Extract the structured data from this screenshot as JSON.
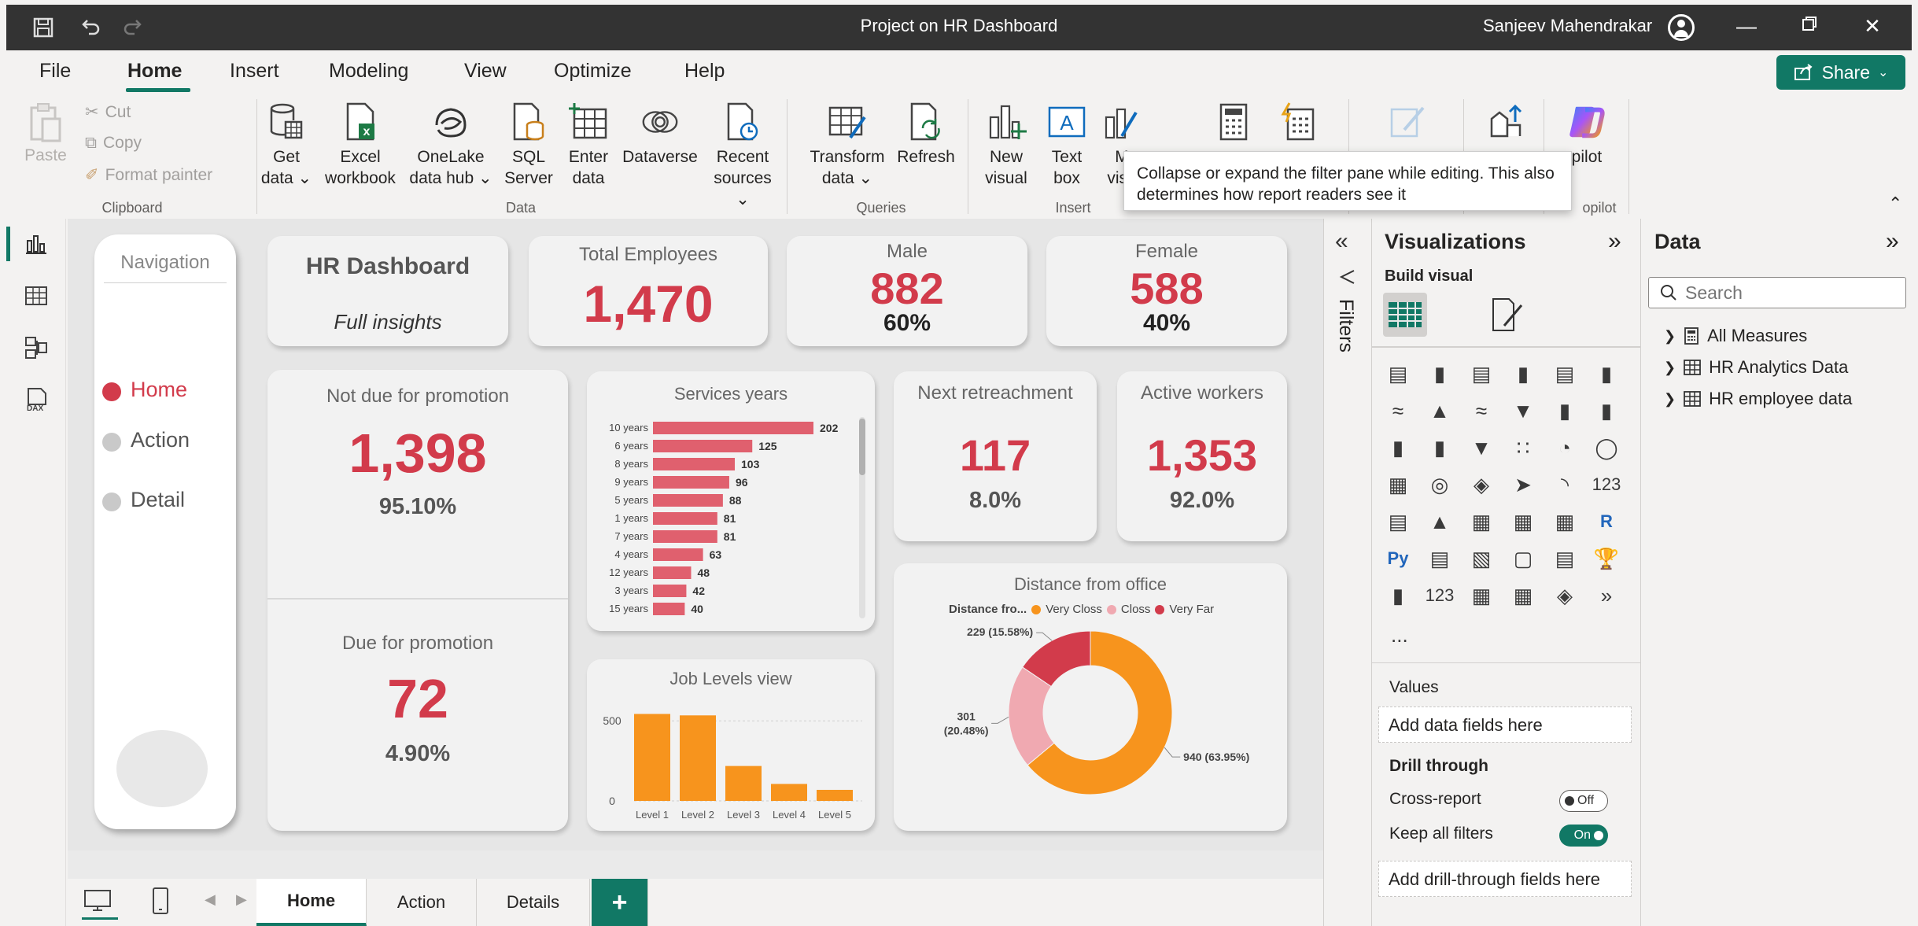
{
  "window": {
    "title": "Project on HR Dashboard",
    "user": "Sanjeev Mahendrakar"
  },
  "menu": {
    "items": [
      "File",
      "Home",
      "Insert",
      "Modeling",
      "View",
      "Optimize",
      "Help"
    ],
    "share_label": "Share"
  },
  "ribbon": {
    "clipboard": {
      "paste": "Paste",
      "cut": "Cut",
      "copy": "Copy",
      "format_painter": "Format painter",
      "group": "Clipboard"
    },
    "data": {
      "get_data": [
        "Get",
        "data"
      ],
      "excel": [
        "Excel",
        "workbook"
      ],
      "onelake": [
        "OneLake",
        "data hub"
      ],
      "sql": [
        "SQL",
        "Server"
      ],
      "enter": [
        "Enter",
        "data"
      ],
      "dataverse": "Dataverse",
      "recent": [
        "Recent",
        "sources"
      ],
      "group": "Data"
    },
    "queries": {
      "transform": [
        "Transform",
        "data"
      ],
      "refresh": "Refresh",
      "group": "Queries"
    },
    "insert": {
      "new_visual": [
        "New",
        "visual"
      ],
      "text_box": [
        "Text",
        "box"
      ],
      "more_visuals": [
        "M",
        "visu"
      ],
      "group": "Insert"
    },
    "copilot": {
      "label": "opilot",
      "group": "opilot"
    }
  },
  "tooltip": {
    "text": "Collapse or expand the filter pane while editing. This also determines how report readers see it"
  },
  "report": {
    "navigation": {
      "title": "Navigation",
      "items": [
        "Home",
        "Action",
        "Detail"
      ]
    },
    "header_card": {
      "title": "HR Dashboard",
      "subtitle": "Full insights"
    },
    "total_employees": {
      "title": "Total Employees",
      "value": "1,470"
    },
    "male": {
      "title": "Male",
      "value": "882",
      "pct": "60%"
    },
    "female": {
      "title": "Female",
      "value": "588",
      "pct": "40%"
    },
    "not_due": {
      "title": "Not due for promotion",
      "value": "1,398",
      "pct": "95.10%"
    },
    "due": {
      "title": "Due for promotion",
      "value": "72",
      "pct": "4.90%"
    },
    "retreachment": {
      "title": "Next retreachment",
      "value": "117",
      "pct": "8.0%"
    },
    "active": {
      "title": "Active workers",
      "value": "1,353",
      "pct": "92.0%"
    }
  },
  "chart_data": [
    {
      "type": "bar",
      "orientation": "horizontal",
      "title": "Services years",
      "categories": [
        "10 years",
        "6 years",
        "8 years",
        "9 years",
        "5 years",
        "1 years",
        "7 years",
        "4 years",
        "12 years",
        "3 years",
        "15 years"
      ],
      "values": [
        202,
        125,
        103,
        96,
        88,
        81,
        81,
        63,
        48,
        42,
        40
      ],
      "color": "#e0606e"
    },
    {
      "type": "bar",
      "title": "Job Levels view",
      "categories": [
        "Level 1",
        "Level 2",
        "Level 3",
        "Level 4",
        "Level 5"
      ],
      "values": [
        543,
        534,
        218,
        106,
        69
      ],
      "yticks": [
        "0",
        "500"
      ],
      "ylim": [
        0,
        560
      ],
      "color": "#f7941d"
    },
    {
      "type": "pie",
      "donut": true,
      "title": "Distance from office",
      "legend_title": "Distance fro...",
      "labels": [
        "Very Closs",
        "Closs",
        "Very Far"
      ],
      "values": [
        940,
        301,
        229
      ],
      "percent_labels": [
        "940 (63.95%)",
        "301 (20.48%)",
        "229 (15.58%)"
      ],
      "colors": [
        "#f7941d",
        "#f0a9b1",
        "#d23b4b"
      ]
    }
  ],
  "filters": {
    "label": "Filters"
  },
  "visualizations": {
    "title": "Visualizations",
    "build_visual": "Build visual",
    "values_label": "Values",
    "add_fields": "Add data fields here",
    "drill_through": "Drill through",
    "cross_report": "Cross-report",
    "cross_report_state": "Off",
    "keep_filters": "Keep all filters",
    "keep_filters_state": "On",
    "add_drill": "Add drill-through fields here",
    "more": "..."
  },
  "data_pane": {
    "title": "Data",
    "search_placeholder": "Search",
    "items": [
      "All Measures",
      "HR Analytics Data",
      "HR employee data"
    ]
  },
  "page_tabs": {
    "tabs": [
      "Home",
      "Action",
      "Details"
    ],
    "add": "+"
  }
}
